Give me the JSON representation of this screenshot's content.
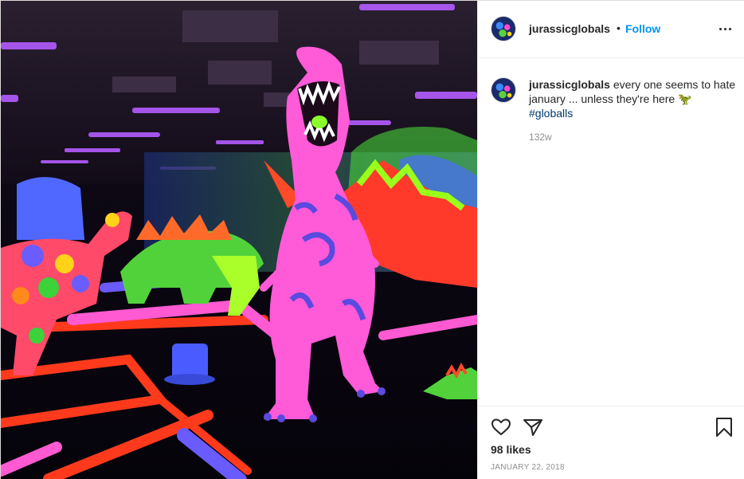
{
  "post": {
    "username": "jurassicglobals",
    "follow_label": "Follow",
    "separator": "•",
    "caption_text": "every one seems to hate january ... unless they're here 🦖",
    "hashtag": "#globalls",
    "caption_age": "132w",
    "likes": "98 likes",
    "date": "JANUARY 22, 2018"
  },
  "icons": {
    "like": "heart-icon",
    "share": "paper-plane-icon",
    "save": "bookmark-icon",
    "more": "more-options-icon"
  },
  "colors": {
    "follow": "#0095f6",
    "hashtag": "#00376b",
    "muted": "#8e8e8e"
  }
}
